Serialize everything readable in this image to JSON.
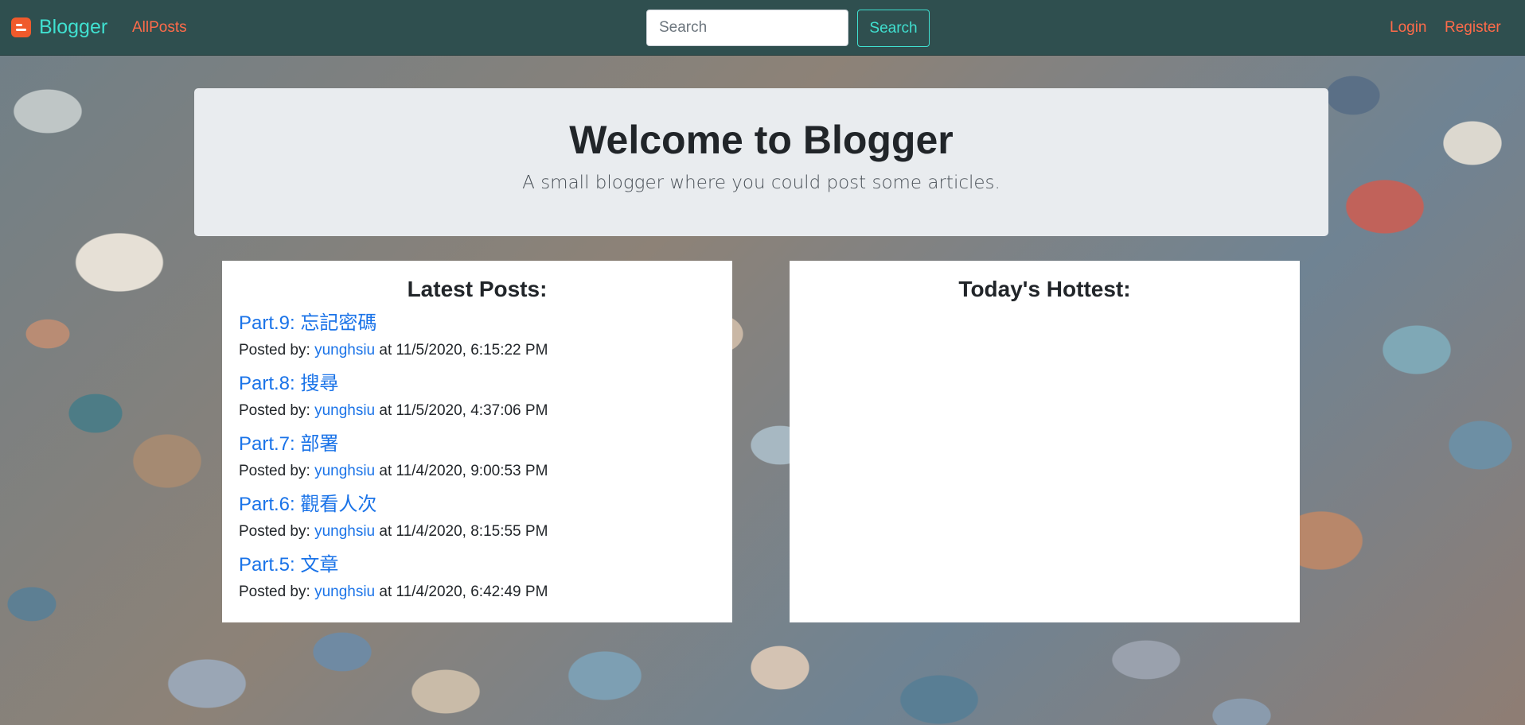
{
  "navbar": {
    "brand": "Blogger",
    "brand_icon": "blogger-icon",
    "allposts": "AllPosts",
    "search_placeholder": "Search",
    "search_button": "Search",
    "login": "Login",
    "register": "Register",
    "colors": {
      "background": "#2f4f4f",
      "brand": "#40e0d0",
      "link": "#ff6b4a"
    }
  },
  "hero": {
    "title": "Welcome to Blogger",
    "subtitle": "A small blogger where you could post some articles."
  },
  "latest": {
    "heading": "Latest Posts:",
    "posted_by_label": "Posted by:",
    "at_label": "at",
    "posts": [
      {
        "title": "Part.9: 忘記密碼",
        "author": "yunghsiu",
        "timestamp": "11/5/2020, 6:15:22 PM"
      },
      {
        "title": "Part.8: 搜尋",
        "author": "yunghsiu",
        "timestamp": "11/5/2020, 4:37:06 PM"
      },
      {
        "title": "Part.7: 部署",
        "author": "yunghsiu",
        "timestamp": "11/4/2020, 9:00:53 PM"
      },
      {
        "title": "Part.6: 觀看人次",
        "author": "yunghsiu",
        "timestamp": "11/4/2020, 8:15:55 PM"
      },
      {
        "title": "Part.5: 文章",
        "author": "yunghsiu",
        "timestamp": "11/4/2020, 6:42:49 PM"
      }
    ]
  },
  "hottest": {
    "heading": "Today's Hottest:"
  }
}
